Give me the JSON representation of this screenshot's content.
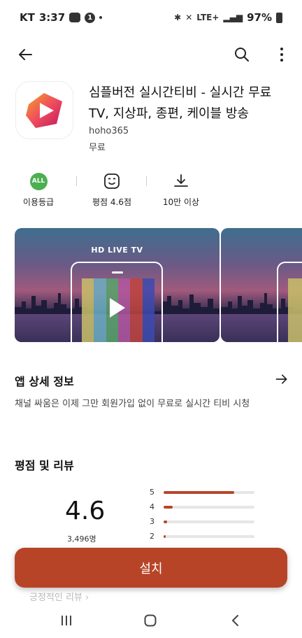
{
  "status_bar": {
    "carrier": "KT",
    "time": "3:37",
    "notif_count": "1",
    "network": "LTE+",
    "battery": "97%"
  },
  "icons": {
    "back": "arrow-left-icon",
    "search": "search-icon",
    "more": "more-vert-icon",
    "detail_arrow": "arrow-right-icon",
    "download": "download-icon",
    "rating_face": "smile-icon"
  },
  "app": {
    "title": "심플버전 실시간티비 - 실시간 무료 TV, 지상파, 종편, 케이블 방송",
    "developer": "hoho365",
    "price": "무료"
  },
  "info": {
    "age_badge": "ALL",
    "age_label": "이용등급",
    "rating_label": "평점 4.6점",
    "downloads_label": "10만 이상"
  },
  "screenshots": {
    "caption": "HD LIVE TV"
  },
  "details": {
    "title": "앱 상세 정보",
    "description": "채널 싸움은 이제 그만 회원가입 없이 무료로 실시간 티비 시청"
  },
  "ratings": {
    "title": "평점 및 리뷰",
    "score": "4.6",
    "count": "3,496명",
    "bars": [
      {
        "star": "5",
        "fraction": 0.78
      },
      {
        "star": "4",
        "fraction": 0.1
      },
      {
        "star": "3",
        "fraction": 0.04
      },
      {
        "star": "2",
        "fraction": 0.01
      }
    ],
    "positive_label": "긍정적인 리뷰"
  },
  "install": {
    "label": "설치"
  },
  "colors": {
    "accent": "#b84427",
    "age_green": "#4caf50"
  }
}
